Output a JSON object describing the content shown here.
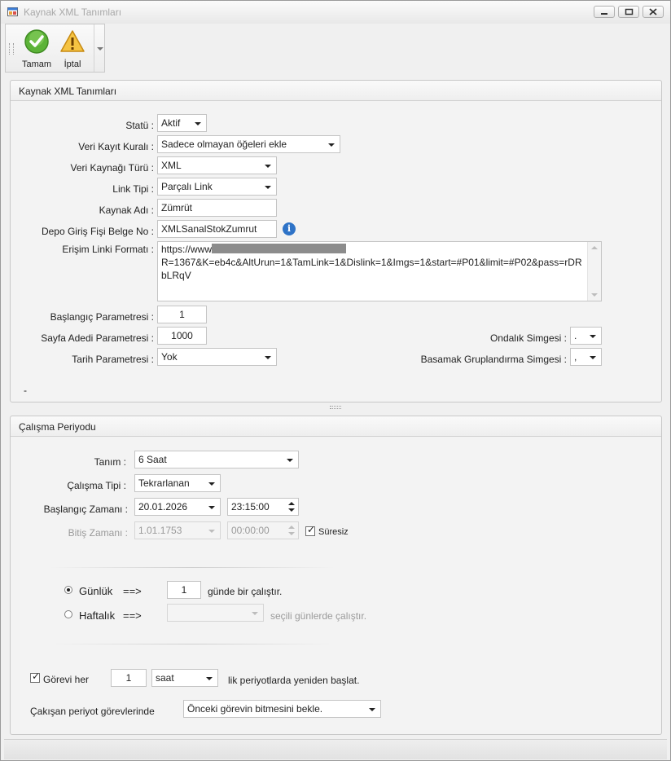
{
  "window": {
    "title": "Kaynak XML Tanımları"
  },
  "toolbar": {
    "ok_label": "Tamam",
    "cancel_label": "İptal"
  },
  "source_group": {
    "title": "Kaynak XML Tanımları",
    "status_label": "Statü :",
    "status_value": "Aktif",
    "record_rule_label": "Veri Kayıt Kuralı :",
    "record_rule_value": "Sadece olmayan öğeleri ekle",
    "source_type_label": "Veri Kaynağı Türü :",
    "source_type_value": "XML",
    "link_type_label": "Link Tipi :",
    "link_type_value": "Parçalı Link",
    "source_name_label": "Kaynak Adı :",
    "source_name_value": "Zümrüt",
    "receipt_label": "Depo Giriş Fişi Belge No :",
    "receipt_value": "XMLSanalStokZumrut",
    "url_format_label": "Erişim Linki Formatı :",
    "url_prefix": "https://www",
    "url_rest": "R=1367&K=eb4c&AltUrun=1&TamLink=1&Dislink=1&Imgs=1&start=#P01&limit=#P02&pass=rDRbLRqV",
    "start_param_label": "Başlangıç Parametresi :",
    "start_param_value": "1",
    "page_count_label": "Sayfa Adedi Parametresi :",
    "page_count_value": "1000",
    "date_param_label": "Tarih Parametresi :",
    "date_param_value": "Yok",
    "decimal_label": "Ondalık Simgesi :",
    "decimal_value": ".",
    "grouping_label": "Basamak Gruplandırma Simgesi :",
    "grouping_value": ",",
    "footer_dash": "-"
  },
  "period_group": {
    "title": "Çalışma Periyodu",
    "definition_label": "Tanım :",
    "definition_value": "6 Saat",
    "run_type_label": "Çalışma Tipi :",
    "run_type_value": "Tekrarlanan",
    "start_time_label": "Başlangıç Zamanı :",
    "start_date": "20.01.2026",
    "start_clock": "23:15:00",
    "end_time_label": "Bitiş Zamanı :",
    "end_date": "1.01.1753",
    "end_clock": "00:00:00",
    "unlimited_label": "Süresiz",
    "unlimited_checked": true,
    "daily_label": "Günlük",
    "daily_arrow": "==>",
    "daily_value": "1",
    "daily_suffix": "günde bir çalıştır.",
    "weekly_label": "Haftalık",
    "weekly_arrow": "==>",
    "weekly_value": "",
    "weekly_suffix": "seçili günlerde çalıştır.",
    "restart_label": "Görevi her",
    "restart_checked": true,
    "restart_value": "1",
    "restart_unit": "saat",
    "restart_suffix": "lik periyotlarda yeniden başlat.",
    "conflict_label": "Çakışan periyot görevlerinde",
    "conflict_value": "Önceki görevin bitmesini bekle."
  },
  "colors": {
    "info_icon": "#2e73c7",
    "disabled_text": "#9a9a9a"
  }
}
